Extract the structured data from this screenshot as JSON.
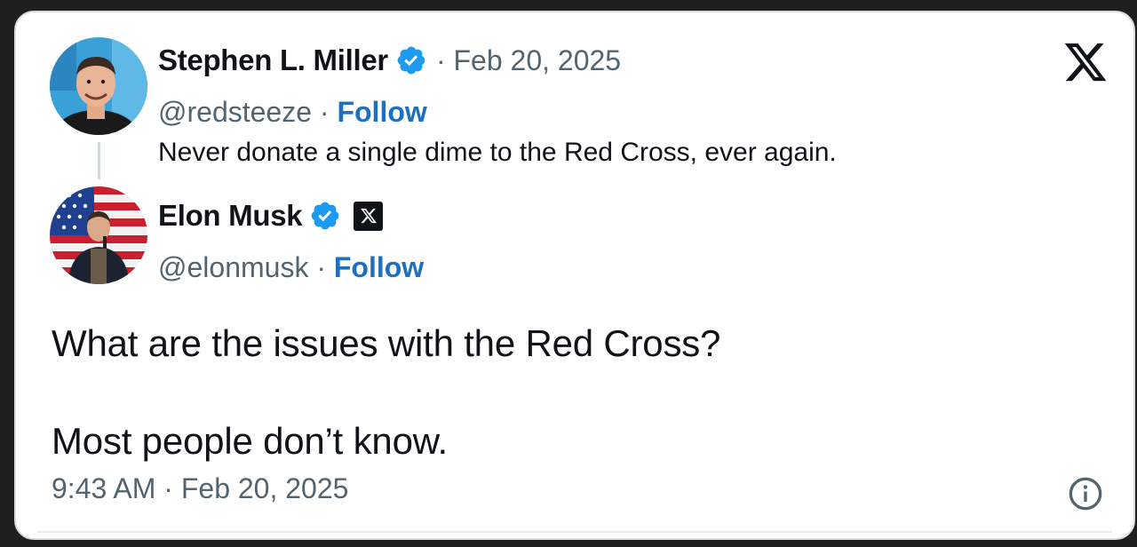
{
  "parent_tweet": {
    "display_name": "Stephen L. Miller",
    "verified": true,
    "date": "Feb 20, 2025",
    "handle": "@redsteeze",
    "separator": "·",
    "follow_label": "Follow",
    "text": "Never donate a single dime to the Red Cross, ever again."
  },
  "reply_tweet": {
    "display_name": "Elon Musk",
    "verified": true,
    "affiliate_badge_icon": "x-logo-icon",
    "handle": "@elonmusk",
    "separator": "·",
    "follow_label": "Follow",
    "text_lines": [
      "What are the issues with the Red Cross?",
      "Most people don’t know."
    ],
    "timestamp": "9:43 AM · Feb 20, 2025"
  },
  "icons": {
    "brand": "x-logo-icon",
    "info": "info-icon",
    "verified": "verified-badge-icon"
  },
  "colors": {
    "accent_link": "#1d6fbf",
    "verified_blue": "#1d9bf0",
    "text_primary": "#0f1419",
    "text_secondary": "#536471"
  }
}
